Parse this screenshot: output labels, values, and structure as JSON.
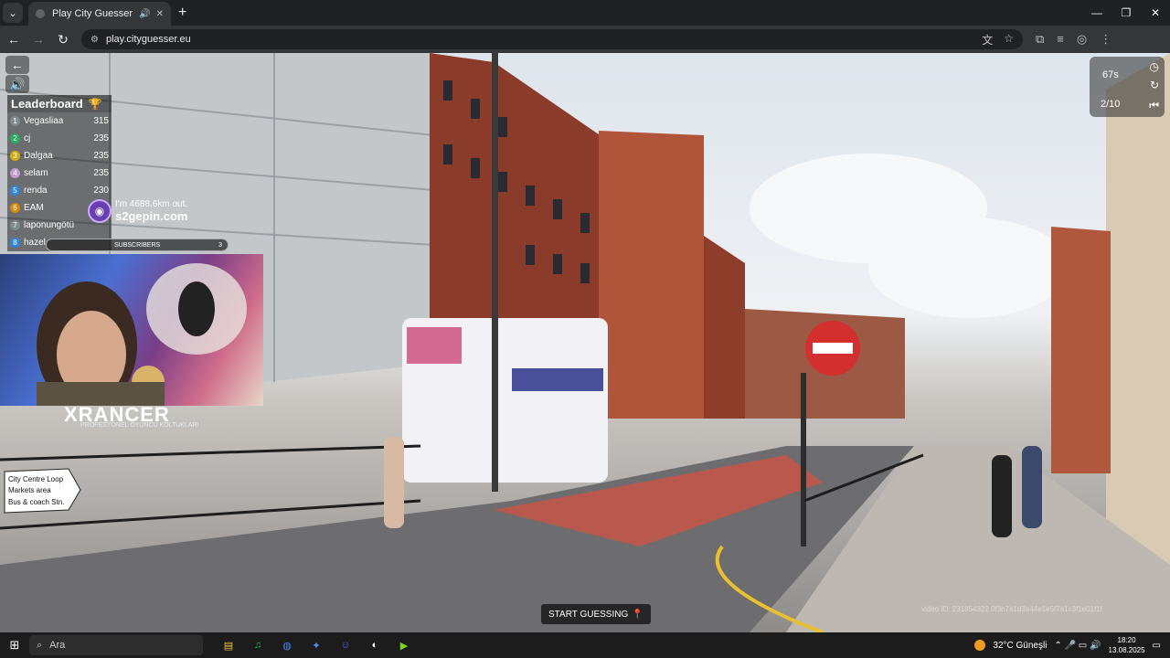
{
  "browser": {
    "tab_title": "Play City Guesser - Explore",
    "url": "play.cityguesser.eu",
    "icons": {
      "tab_menu": "chevron-down-icon",
      "audio": "audio-icon",
      "close": "close-icon",
      "new_tab": "plus-icon",
      "back": "back-arrow-icon",
      "forward": "forward-arrow-icon",
      "reload": "reload-icon",
      "translate": "translate-icon",
      "bookmark": "star-icon",
      "extensions": "puzzle-icon",
      "media": "media-icon",
      "profile": "profile-icon",
      "menu": "kebab-menu-icon"
    },
    "glyphs": {
      "tab_menu": "⌄",
      "audio": "🔊",
      "close": "✕",
      "new_tab": "+",
      "minimize": "—",
      "maximize": "❐",
      "window_close": "✕",
      "back": "←",
      "forward": "→",
      "reload": "↻",
      "site": "⚙",
      "translate": "文",
      "star": "☆",
      "puzzle": "⧉",
      "media": "≡",
      "profile": "◎",
      "menu": "⋮"
    }
  },
  "game": {
    "back_glyph": "←",
    "sound_glyph": "🔊",
    "leaderboard": {
      "title": "Leaderboard",
      "trophy_glyph": "🏆",
      "rows": [
        {
          "rank": "1",
          "name": "Vegasliaa",
          "score": "315",
          "color": "#7f8c8d"
        },
        {
          "rank": "2",
          "name": "cj",
          "score": "235",
          "color": "#27ae60"
        },
        {
          "rank": "3",
          "name": "Dalgaa",
          "score": "235",
          "color": "#d4ac0d"
        },
        {
          "rank": "4",
          "name": "selam",
          "score": "235",
          "color": "#c39bd3"
        },
        {
          "rank": "5",
          "name": "renda",
          "score": "230",
          "color": "#2e86de"
        },
        {
          "rank": "6",
          "name": "EAM",
          "score": "",
          "color": "#d68910"
        },
        {
          "rank": "7",
          "name": "laponungötü",
          "score": "",
          "color": "#7f8c8d"
        },
        {
          "rank": "8",
          "name": "hazel",
          "score": "",
          "color": "#2e86de"
        }
      ]
    },
    "timer": {
      "time": "67s",
      "round": "2/10",
      "clock_glyph": "◷",
      "restart_glyph": "↻",
      "skip_glyph": "⏮"
    },
    "start_button": "START GUESSING",
    "pin_glyph": "📍",
    "video_id": "video ID: 231854322 0f3b7a1d3a44e1e5f7a1c3f1e01f1f"
  },
  "stream_overlay": {
    "chat_line": "I'm 4688.6km out.",
    "chat_handle": "s2gepin.com",
    "avatar_glyph": "◉",
    "subscribers_label": "SUBSCRIBERS",
    "subscribers_count": "3",
    "brand": "XRANCER",
    "brand_sub": "PROFESYONEL OYUNCU KOLTUKLARI"
  },
  "street_sign": {
    "line1": "City Centre Loop",
    "line2": "Markets area",
    "line3": "Bus & coach Stn."
  },
  "taskbar": {
    "start_glyph": "⊞",
    "search_glyph": "⌕",
    "search_placeholder": "Ara",
    "pinned": [
      {
        "glyph": "▤",
        "color": "#f0c040"
      },
      {
        "glyph": "♫",
        "color": "#1db954"
      },
      {
        "glyph": "◍",
        "color": "#4285f4"
      },
      {
        "glyph": "✦",
        "color": "#5b8def"
      },
      {
        "glyph": "☺",
        "color": "#5865f2"
      },
      {
        "glyph": "◐",
        "color": "#ffffff"
      },
      {
        "glyph": "▶",
        "color": "#7ed321"
      }
    ],
    "weather": "32°C  Güneşli",
    "tray_glyphs": "⌃ 🎤 ▭ 🔊",
    "time": "18:20",
    "date": "13.08.2025",
    "notification_glyph": "▭"
  }
}
